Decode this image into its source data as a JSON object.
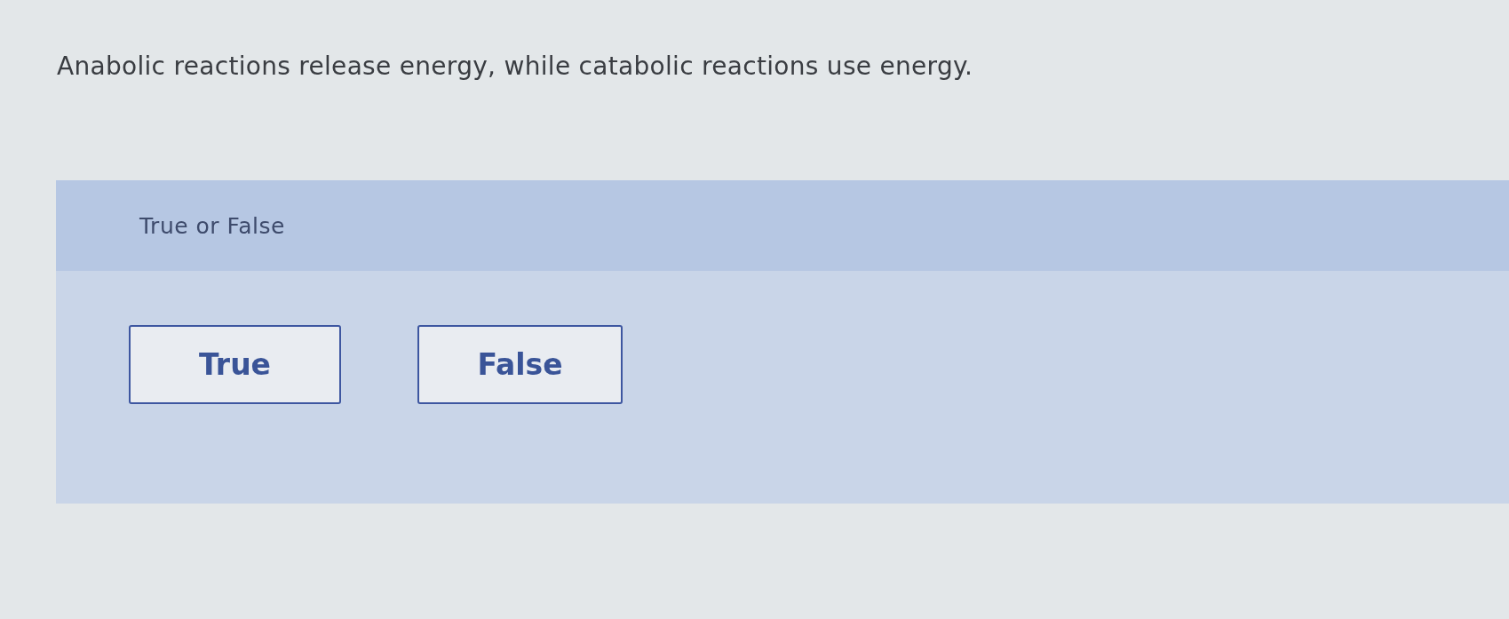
{
  "question": {
    "text": "Anabolic reactions release energy, while catabolic reactions use energy."
  },
  "answer_panel": {
    "prompt": "True or False",
    "options": [
      {
        "label": "True",
        "selected": false
      },
      {
        "label": "False",
        "selected": false
      }
    ]
  }
}
